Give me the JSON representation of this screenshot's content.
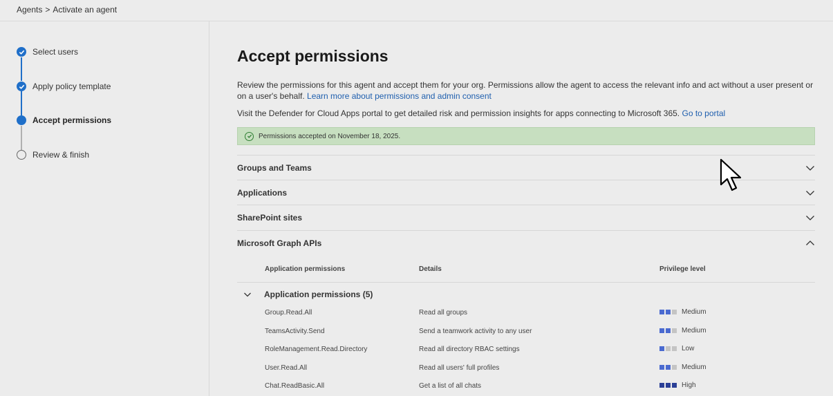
{
  "breadcrumb": {
    "parent": "Agents",
    "separator": ">",
    "current": "Activate an agent"
  },
  "steps": [
    {
      "label": "Select users",
      "state": "done"
    },
    {
      "label": "Apply policy template",
      "state": "done"
    },
    {
      "label": "Accept permissions",
      "state": "current"
    },
    {
      "label": "Review & finish",
      "state": "todo"
    }
  ],
  "main": {
    "title": "Accept permissions",
    "description": "Review the permissions for this agent and accept them for your org. Permissions allow the agent to access the relevant info and act without a user present or on a user's behalf.",
    "learn_more_link": "Learn more about permissions and admin consent",
    "portal_text": "Visit the Defender for Cloud Apps portal to get detailed risk and permission insights for apps connecting to Microsoft 365.",
    "portal_link": "Go to portal",
    "banner_text": "Permissions accepted on November 18, 2025.",
    "sections": [
      {
        "label": "Groups and Teams",
        "expanded": false
      },
      {
        "label": "Applications",
        "expanded": false
      },
      {
        "label": "SharePoint sites",
        "expanded": false
      },
      {
        "label": "Microsoft Graph APIs",
        "expanded": true
      }
    ],
    "table": {
      "headers": {
        "name": "Application permissions",
        "details": "Details",
        "privilege": "Privilege level"
      },
      "group_label": "Application permissions (5)",
      "rows": [
        {
          "name": "Group.Read.All",
          "details": "Read all groups",
          "level": "Medium",
          "level_value": 2
        },
        {
          "name": "TeamsActivity.Send",
          "details": "Send a teamwork activity to any user",
          "level": "Medium",
          "level_value": 2
        },
        {
          "name": "RoleManagement.Read.Directory",
          "details": "Read all directory RBAC settings",
          "level": "Low",
          "level_value": 1
        },
        {
          "name": "User.Read.All",
          "details": "Read all users' full profiles",
          "level": "Medium",
          "level_value": 2
        },
        {
          "name": "Chat.ReadBasic.All",
          "details": "Get a list of all chats",
          "level": "High",
          "level_value": 3
        }
      ]
    }
  },
  "colors": {
    "accent": "#1f6fc9",
    "banner_bg": "#c7dfc0",
    "link": "#1f5fae"
  }
}
